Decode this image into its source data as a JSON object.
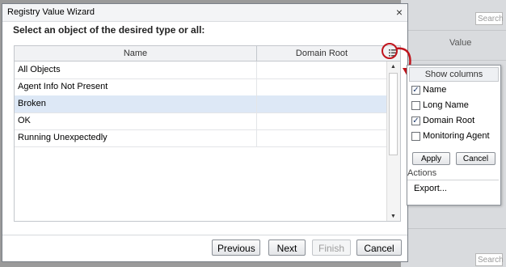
{
  "background": {
    "search_placeholder": "Search",
    "value_header": "Value"
  },
  "dialog": {
    "title": "Registry Value Wizard",
    "heading": "Select an object of the desired type or all:"
  },
  "grid": {
    "columns": [
      "Name",
      "Domain Root"
    ],
    "rows": [
      {
        "name": "All Objects",
        "domain": "",
        "selected": false
      },
      {
        "name": "Agent Info Not Present",
        "domain": "",
        "selected": false
      },
      {
        "name": "Broken",
        "domain": "",
        "selected": true
      },
      {
        "name": "OK",
        "domain": "",
        "selected": false
      },
      {
        "name": "Running Unexpectedly",
        "domain": "",
        "selected": false
      }
    ]
  },
  "buttons": {
    "previous": "Previous",
    "next": "Next",
    "finish": "Finish",
    "cancel": "Cancel"
  },
  "column_chooser": {
    "header": "Show columns",
    "options": [
      {
        "label": "Name",
        "checked": true
      },
      {
        "label": "Long Name",
        "checked": false
      },
      {
        "label": "Domain Root",
        "checked": true
      },
      {
        "label": "Monitoring Agent",
        "checked": false
      }
    ],
    "apply": "Apply",
    "cancel": "Cancel",
    "actions_label": "Actions",
    "export": "Export..."
  },
  "colors": {
    "annotation": "#c0141c",
    "selected_row": "#dde8f6"
  }
}
